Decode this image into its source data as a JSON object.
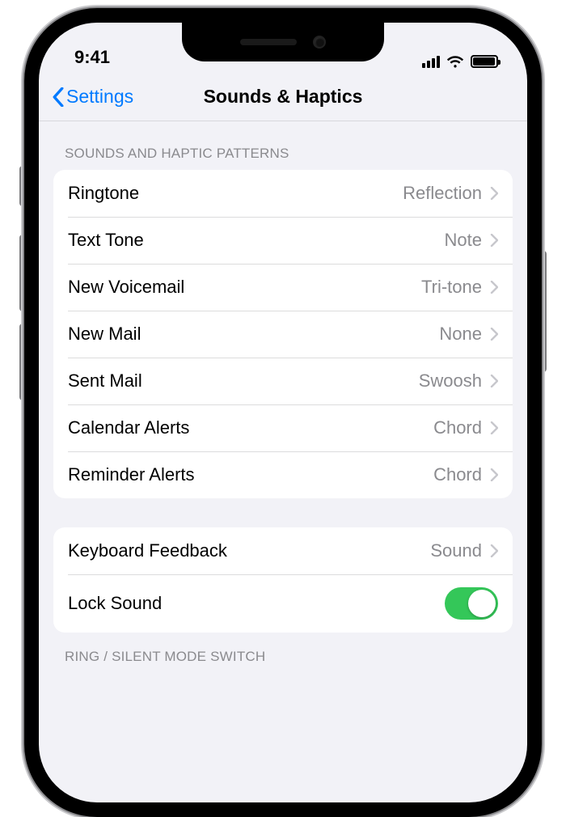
{
  "status": {
    "time": "9:41"
  },
  "nav": {
    "back_label": "Settings",
    "title": "Sounds & Haptics"
  },
  "section1": {
    "header": "SOUNDS AND HAPTIC PATTERNS",
    "rows": [
      {
        "label": "Ringtone",
        "value": "Reflection"
      },
      {
        "label": "Text Tone",
        "value": "Note"
      },
      {
        "label": "New Voicemail",
        "value": "Tri-tone"
      },
      {
        "label": "New Mail",
        "value": "None"
      },
      {
        "label": "Sent Mail",
        "value": "Swoosh"
      },
      {
        "label": "Calendar Alerts",
        "value": "Chord"
      },
      {
        "label": "Reminder Alerts",
        "value": "Chord"
      }
    ]
  },
  "section2": {
    "rows": [
      {
        "label": "Keyboard Feedback",
        "value": "Sound",
        "type": "link"
      },
      {
        "label": "Lock Sound",
        "type": "toggle",
        "on": true
      }
    ]
  },
  "section3": {
    "header": "RING / SILENT MODE SWITCH"
  },
  "colors": {
    "link": "#007aff",
    "toggle_on": "#34c759",
    "secondary": "#8a8a8e",
    "bg": "#f2f2f7"
  }
}
